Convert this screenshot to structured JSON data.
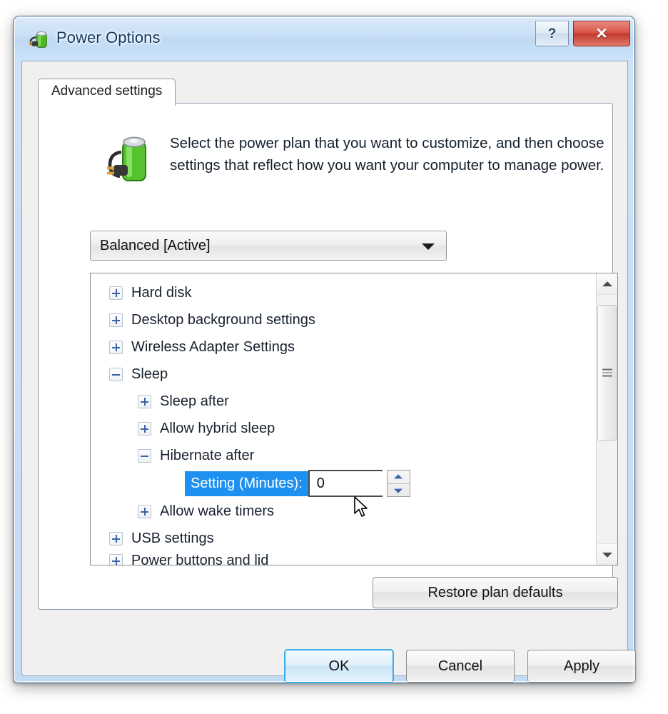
{
  "window": {
    "title": "Power Options",
    "icon": "power-plug-battery-icon",
    "help_label": "?",
    "close_label": "✕",
    "accent_blue": "#1e90f0",
    "titlebar_color": "#c9e0f7",
    "close_button_color": "#c3392c"
  },
  "tabs": [
    {
      "label": "Advanced settings",
      "selected": true
    }
  ],
  "intro": {
    "icon": "battery-power-icon",
    "text": "Select the power plan that you want to customize, and then choose settings that reflect how you want your computer to manage power."
  },
  "plan_select": {
    "value": "Balanced [Active]",
    "arrow_icon": "chevron-down-icon",
    "options": [
      "Balanced [Active]"
    ]
  },
  "tree": {
    "rows": [
      {
        "label": "Hard disk",
        "level": 0,
        "state": "collapsed"
      },
      {
        "label": "Desktop background settings",
        "level": 0,
        "state": "collapsed"
      },
      {
        "label": "Wireless Adapter Settings",
        "level": 0,
        "state": "collapsed"
      },
      {
        "label": "Sleep",
        "level": 0,
        "state": "expanded"
      },
      {
        "label": "Sleep after",
        "level": 1,
        "state": "collapsed"
      },
      {
        "label": "Allow hybrid sleep",
        "level": 1,
        "state": "collapsed"
      },
      {
        "label": "Hibernate after",
        "level": 1,
        "state": "expanded"
      },
      {
        "label": "Allow wake timers",
        "level": 1,
        "state": "collapsed"
      },
      {
        "label": "USB settings",
        "level": 0,
        "state": "collapsed"
      },
      {
        "label": "Power buttons and lid",
        "level": 0,
        "state": "collapsed"
      }
    ],
    "setting": {
      "label": "Setting (Minutes):",
      "value": "0",
      "selected": true,
      "spinner_up_icon": "spinner-up-arrow-icon",
      "spinner_down_icon": "spinner-down-arrow-icon"
    },
    "scrollbar": {
      "up_icon": "scroll-up-arrow-icon",
      "down_icon": "scroll-down-arrow-icon",
      "thumb_grip_icon": "scrollbar-grip-icon"
    }
  },
  "restore": {
    "label": "Restore plan defaults"
  },
  "footer": {
    "ok": "OK",
    "cancel": "Cancel",
    "apply": "Apply"
  },
  "cursor": {
    "icon": "mouse-pointer-arrow"
  }
}
